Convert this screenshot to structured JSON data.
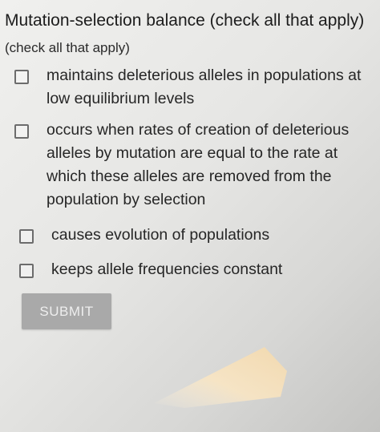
{
  "question": {
    "title": "Mutation-selection balance (check all that apply)",
    "subtitle": "(check all that apply)"
  },
  "options": [
    {
      "label": "maintains deleterious alleles in populations at low equilibrium levels",
      "checked": false
    },
    {
      "label": "occurs when rates of creation of deleterious alleles by mutation are equal to the rate at which these alleles are removed from the population by selection",
      "checked": false
    },
    {
      "label": "causes evolution of populations",
      "checked": false
    },
    {
      "label": "keeps allele frequencies constant",
      "checked": false
    }
  ],
  "submit": {
    "label": "SUBMIT",
    "enabled": false
  },
  "colors": {
    "background": "#e4e4e2",
    "text": "#262626",
    "checkbox_border": "#6c6c6c",
    "submit_bg": "#a9a9a9",
    "submit_text": "#eeeeee"
  }
}
